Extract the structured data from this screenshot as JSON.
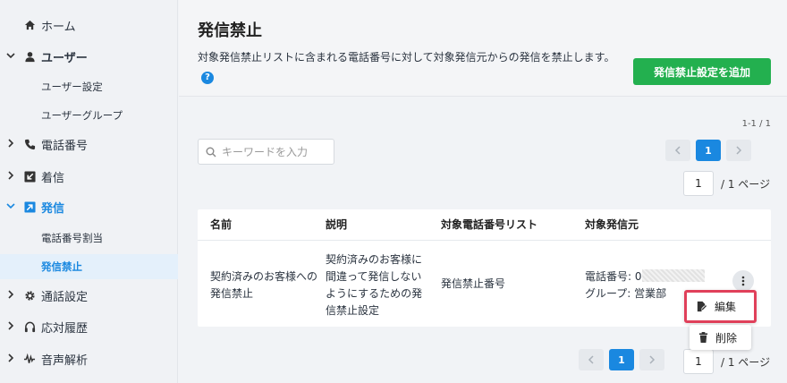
{
  "sidebar": {
    "items": [
      {
        "label": "ホーム",
        "icon": "home-icon"
      },
      {
        "label": "ユーザー",
        "icon": "user-icon",
        "expanded": true
      },
      {
        "label": "ユーザー設定"
      },
      {
        "label": "ユーザーグループ"
      },
      {
        "label": "電話番号",
        "icon": "phone-icon"
      },
      {
        "label": "着信",
        "icon": "incoming-call-icon"
      },
      {
        "label": "発信",
        "icon": "outgoing-call-icon",
        "expanded": true,
        "active": true
      },
      {
        "label": "電話番号割当"
      },
      {
        "label": "発信禁止",
        "selected": true
      },
      {
        "label": "通話設定",
        "icon": "gear-icon"
      },
      {
        "label": "応対履歴",
        "icon": "headset-icon"
      },
      {
        "label": "音声解析",
        "icon": "waveform-icon"
      }
    ]
  },
  "header": {
    "title": "発信禁止",
    "description": "対象発信禁止リストに含まれる電話番号に対して対象発信元からの発信を禁止します。",
    "help_icon_text": "?",
    "add_button_label": "発信禁止設定を追加"
  },
  "main": {
    "count_label": "1-1 / 1",
    "search_placeholder": "キーワードを入力",
    "pagination": {
      "current_page": "1",
      "page_input": "1",
      "total_label": "/ 1 ページ"
    },
    "table": {
      "columns": [
        "名前",
        "説明",
        "対象電話番号リスト",
        "対象発信元"
      ],
      "rows": [
        {
          "name": "契約済みのお客様への発信禁止",
          "description": "契約済みのお客様に間違って発信しないようにするための発信禁止設定",
          "number_list": "発信禁止番号",
          "source_phone_prefix": "電話番号: 0",
          "source_group": "グループ: 営業部"
        }
      ]
    },
    "row_menu": {
      "edit_label": "編集",
      "delete_label": "削除"
    }
  },
  "colors": {
    "accent": "#1a88e0",
    "add_button": "#23b04f",
    "highlight_border": "#e0405a"
  }
}
